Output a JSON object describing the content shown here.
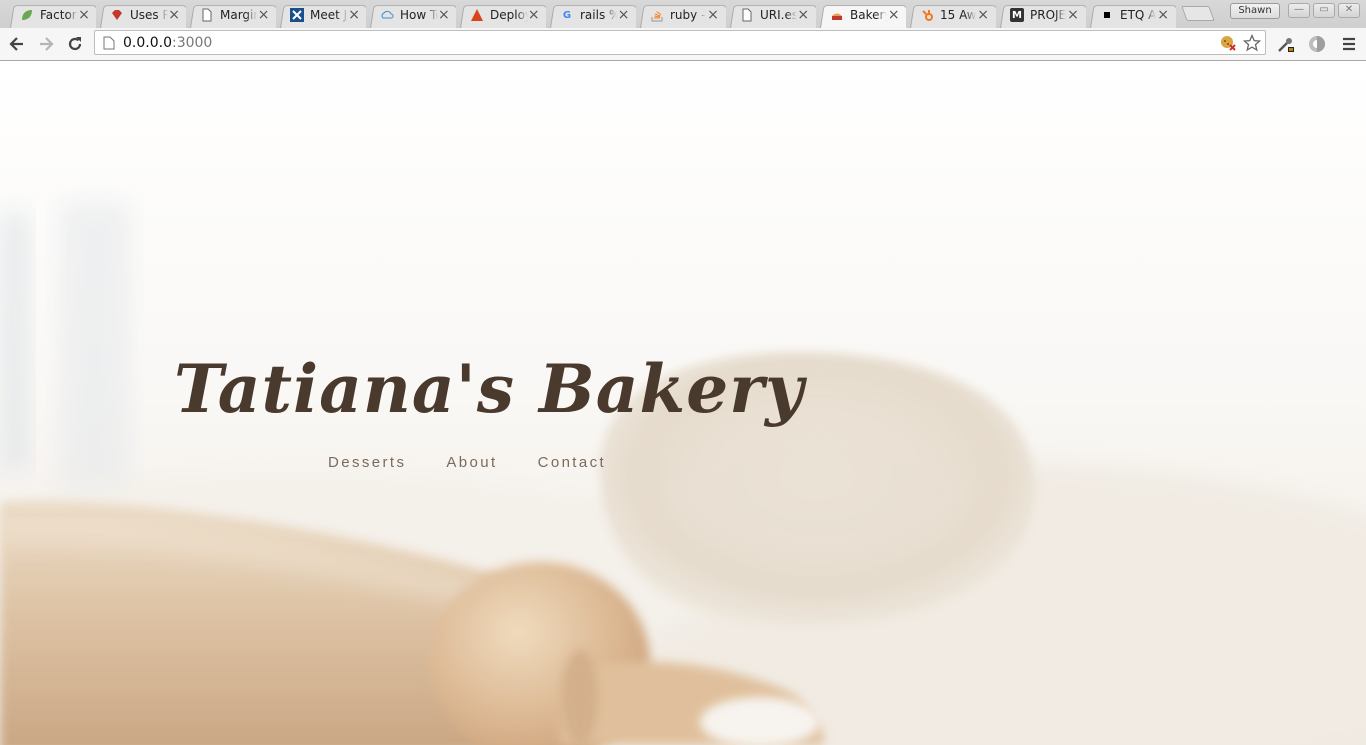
{
  "browser": {
    "tabs": [
      {
        "title": "Factory",
        "icon": "leaf-icon",
        "active": false
      },
      {
        "title": "Uses Ruby",
        "icon": "ruby-icon",
        "active": false
      },
      {
        "title": "Margin",
        "icon": "page-icon",
        "active": false
      },
      {
        "title": "Meet Jekyll",
        "icon": "cross-icon",
        "active": false
      },
      {
        "title": "How To",
        "icon": "cloud-icon",
        "active": false
      },
      {
        "title": "Deploy",
        "icon": "deploy-icon",
        "active": false
      },
      {
        "title": "rails %",
        "icon": "google-icon",
        "active": false
      },
      {
        "title": "ruby -",
        "icon": "stackoverflow-icon",
        "active": false
      },
      {
        "title": "URI.es",
        "icon": "page-icon",
        "active": false
      },
      {
        "title": "Bakery",
        "icon": "cake-icon",
        "active": true
      },
      {
        "title": "15 Aw",
        "icon": "hubspot-icon",
        "active": false
      },
      {
        "title": "PROJE",
        "icon": "medium-icon",
        "active": false
      },
      {
        "title": "ETQ A",
        "icon": "square-icon",
        "active": false
      }
    ],
    "profile_name": "Shawn",
    "address": {
      "host": "0.0.0.0",
      "port": ":3000"
    }
  },
  "site": {
    "title": "Tatiana's Bakery",
    "nav": [
      "Desserts",
      "About",
      "Contact"
    ]
  },
  "colors": {
    "title": "#4a3a2e",
    "nav": "#7b6a5c"
  }
}
